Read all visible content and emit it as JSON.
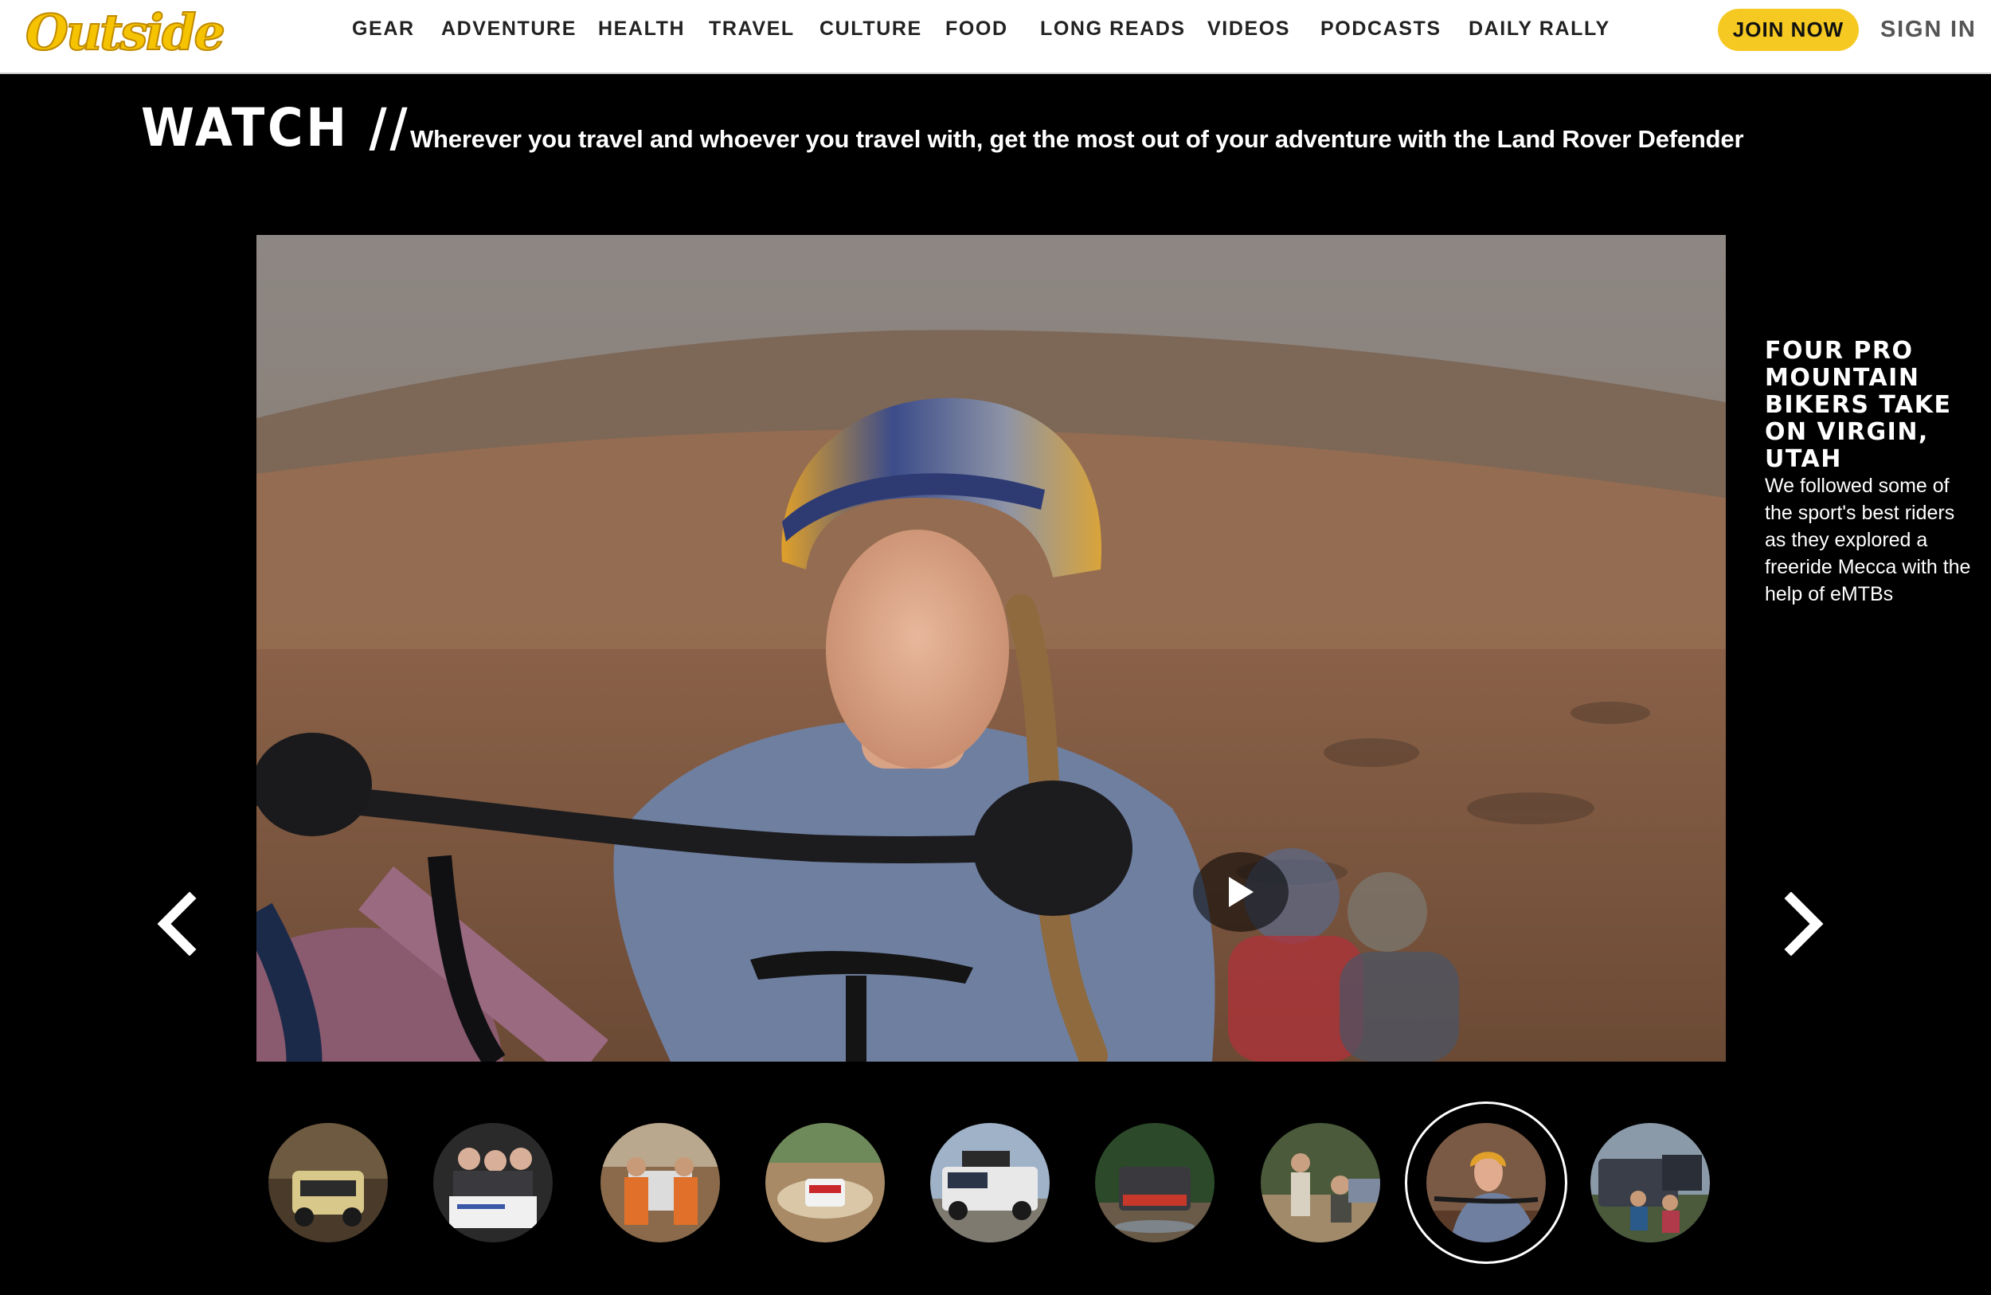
{
  "site": {
    "logo_text": "Outside",
    "brand_color": "#f5c300"
  },
  "nav": {
    "items": [
      "GEAR",
      "ADVENTURE",
      "HEALTH",
      "TRAVEL",
      "CULTURE",
      "FOOD",
      "LONG READS",
      "VIDEOS",
      "PODCASTS",
      "DAILY RALLY"
    ],
    "join_label": "JOIN NOW",
    "sign_in_label": "SIGN IN",
    "join_color": "#f5c921"
  },
  "header": {
    "title": "WATCH //",
    "subtitle": "Wherever you travel and whoever you travel with, get the most out of your adventure with the Land Rover Defender"
  },
  "video": {
    "title": "FOUR PRO MOUNTAIN BIKERS TAKE ON VIRGIN, UTAH",
    "description": "We followed some of the sport's best riders as they explored a freeride Mecca with the help of eMTBs",
    "play_icon": "play-icon",
    "prev_icon": "chevron-left-icon",
    "next_icon": "chevron-right-icon"
  },
  "thumbnails": {
    "count": 9,
    "active_index": 7
  }
}
